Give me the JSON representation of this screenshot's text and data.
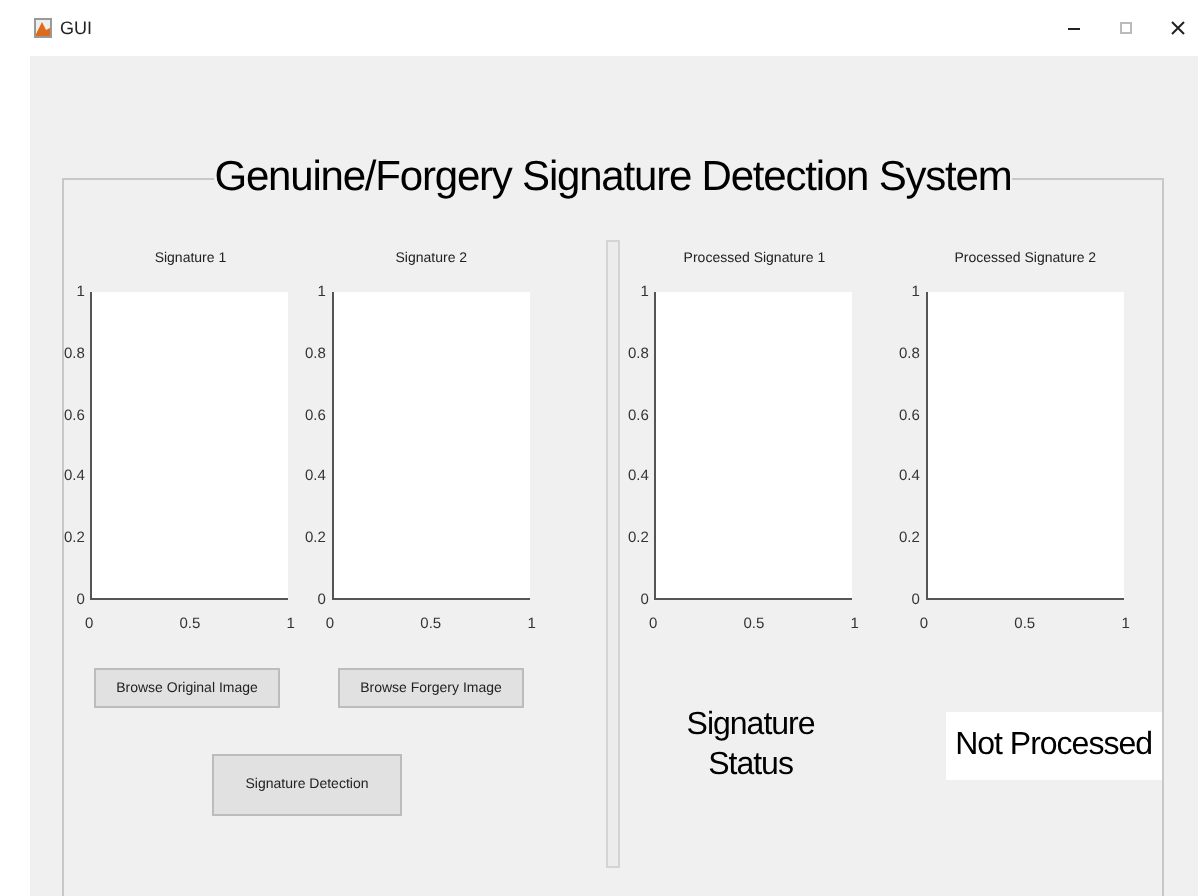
{
  "window": {
    "title": "GUI"
  },
  "panel": {
    "title": "Genuine/Forgery Signature Detection System"
  },
  "axes": [
    {
      "title": "Signature 1",
      "yticks": [
        "1",
        "0.8",
        "0.6",
        "0.4",
        "0.2",
        "0"
      ],
      "xticks": [
        "0",
        "0.5",
        "1"
      ]
    },
    {
      "title": "Signature 2",
      "yticks": [
        "1",
        "0.8",
        "0.6",
        "0.4",
        "0.2",
        "0"
      ],
      "xticks": [
        "0",
        "0.5",
        "1"
      ]
    },
    {
      "title": "Processed Signature 1",
      "yticks": [
        "1",
        "0.8",
        "0.6",
        "0.4",
        "0.2",
        "0"
      ],
      "xticks": [
        "0",
        "0.5",
        "1"
      ]
    },
    {
      "title": "Processed Signature 2",
      "yticks": [
        "1",
        "0.8",
        "0.6",
        "0.4",
        "0.2",
        "0"
      ],
      "xticks": [
        "0",
        "0.5",
        "1"
      ]
    }
  ],
  "buttons": {
    "browse_original": "Browse Original Image",
    "browse_forgery": "Browse Forgery Image",
    "detect": "Signature Detection"
  },
  "status": {
    "label": "Signature Status",
    "value": "Not Processed"
  }
}
